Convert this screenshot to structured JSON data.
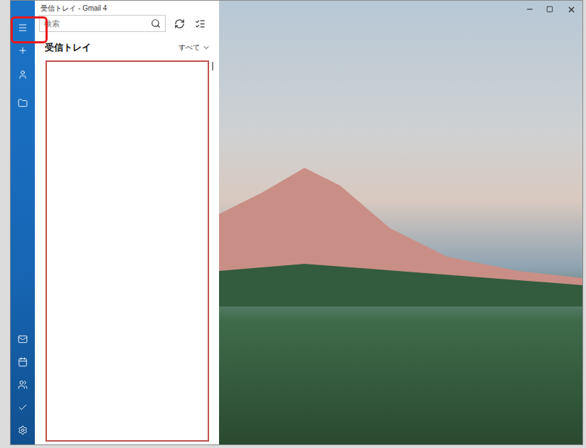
{
  "window": {
    "title": "受信トレイ - Gmail 4"
  },
  "search": {
    "placeholder": "検索"
  },
  "folder": {
    "title": "受信トレイ",
    "filter": "すべて"
  },
  "message_list": {
    "rows": []
  },
  "annotations": [
    {
      "target": "menu-button",
      "color": "#e8181c"
    },
    {
      "target": "message-list",
      "color": "#c0504d"
    }
  ]
}
